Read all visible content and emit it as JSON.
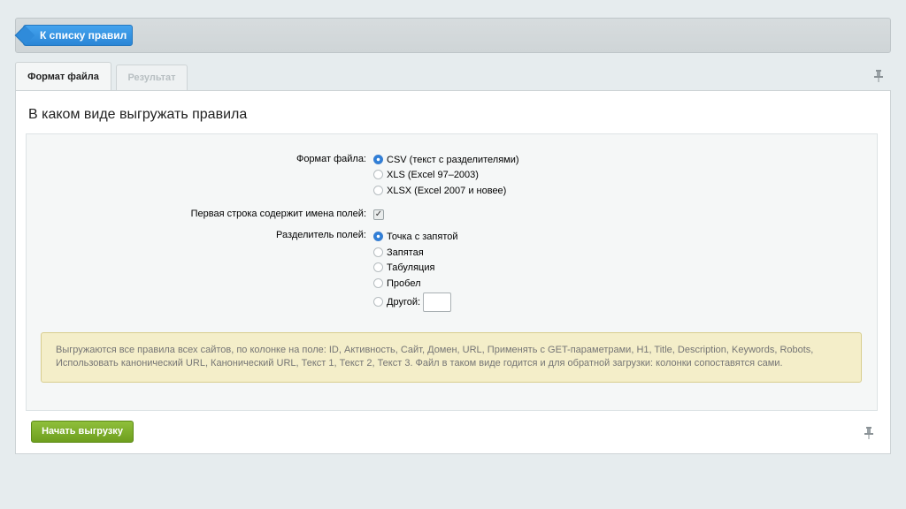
{
  "toolbar": {
    "back_label": "К списку правил"
  },
  "tabs": [
    {
      "label": "Формат файла",
      "active": true
    },
    {
      "label": "Результат",
      "active": false
    }
  ],
  "heading": "В каком виде выгружать правила",
  "form": {
    "format_label": "Формат файла:",
    "format_options": [
      {
        "label": "CSV (текст с разделителями)",
        "checked": true
      },
      {
        "label": "XLS (Excel 97–2003)",
        "checked": false
      },
      {
        "label": "XLSX (Excel 2007 и новее)",
        "checked": false
      }
    ],
    "first_row_label": "Первая строка содержит имена полей:",
    "first_row_checked": true,
    "separator_label": "Разделитель полей:",
    "separator_options": [
      {
        "label": "Точка с запятой",
        "checked": true
      },
      {
        "label": "Запятая",
        "checked": false
      },
      {
        "label": "Табуляция",
        "checked": false
      },
      {
        "label": "Пробел",
        "checked": false
      },
      {
        "label": "Другой:",
        "checked": false
      }
    ],
    "other_value": ""
  },
  "note": "Выгружаются все правила всех сайтов, по колонке на поле: ID, Активность, Сайт, Домен, URL, Применять с GET-параметрами, H1, Title, Description, Keywords, Robots, Использовать канонический URL, Канонический URL, Текст 1, Текст 2, Текст 3. Файл в таком виде годится и для обратной загрузки: колонки сопоставятся сами.",
  "actions": {
    "start_label": "Начать выгрузку"
  },
  "icons": {
    "pin": "pin-icon",
    "back_arrow": "arrow-left-icon"
  },
  "colors": {
    "back_button": "#2f8bda",
    "start_button": "#7aaa28",
    "note_bg": "#f4eec9"
  }
}
